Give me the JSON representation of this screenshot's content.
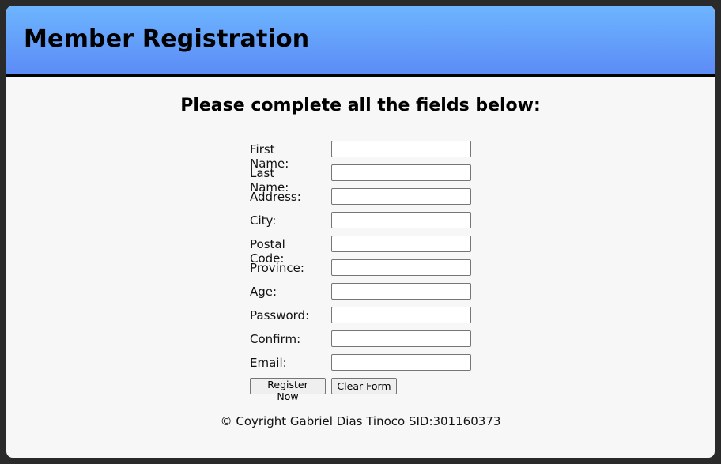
{
  "header": {
    "title": "Member Registration"
  },
  "subtitle": "Please complete all the fields below:",
  "form": {
    "fields": [
      {
        "label": "First Name:",
        "value": ""
      },
      {
        "label": "Last Name:",
        "value": ""
      },
      {
        "label": "Address:",
        "value": ""
      },
      {
        "label": "City:",
        "value": ""
      },
      {
        "label": "Postal Code:",
        "value": ""
      },
      {
        "label": "Province:",
        "value": ""
      },
      {
        "label": "Age:",
        "value": ""
      },
      {
        "label": "Password:",
        "value": ""
      },
      {
        "label": "Confirm:",
        "value": ""
      },
      {
        "label": "Email:",
        "value": ""
      }
    ],
    "register_label": "Register Now",
    "clear_label": "Clear Form"
  },
  "footer": {
    "copyright": "© Coyright Gabriel Dias Tinoco SID:301160373"
  },
  "colors": {
    "header_gradient_top": "#6db5ff",
    "header_gradient_bottom": "#5c8cf6",
    "page_background": "#f7f7f7",
    "outer_background": "#2a2a2a"
  }
}
